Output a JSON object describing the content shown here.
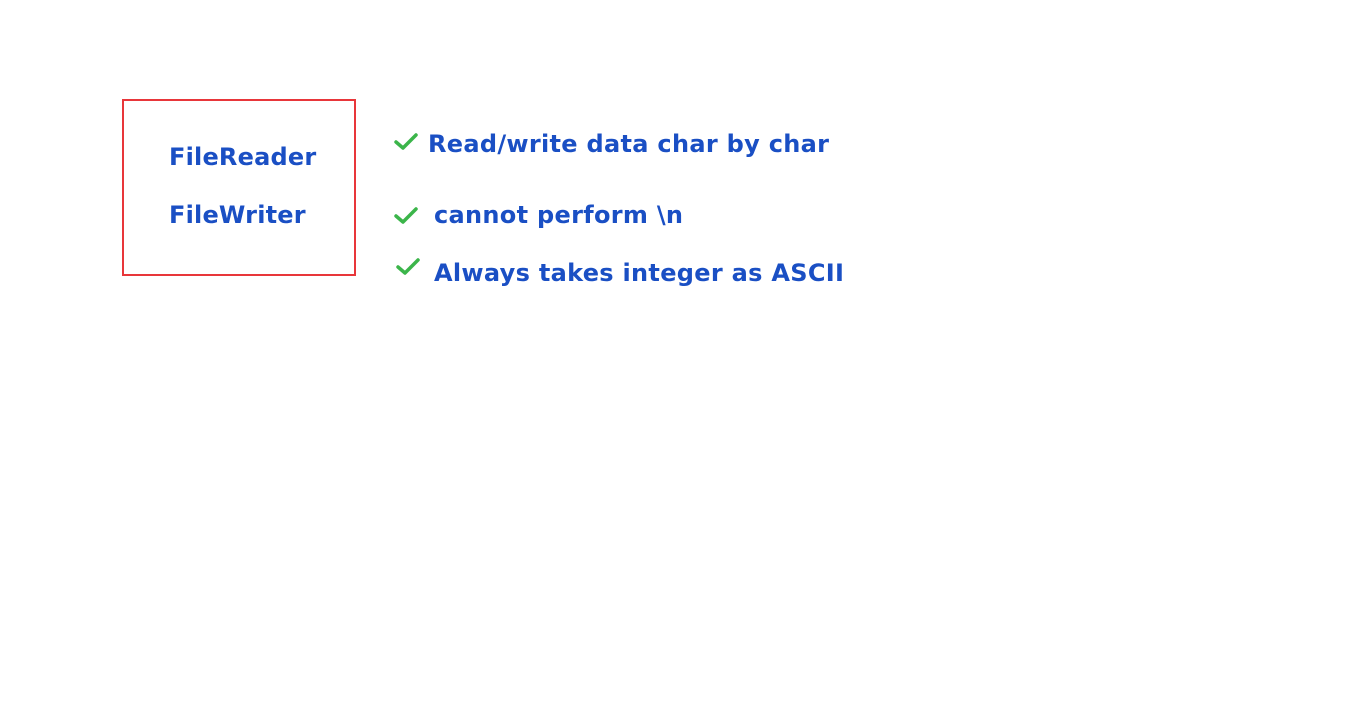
{
  "box": {
    "items": [
      "FileReader",
      "FileWriter"
    ],
    "border_color": "#e8363a"
  },
  "points": [
    {
      "icon": "check-icon",
      "text": "Read/write data char by char"
    },
    {
      "icon": "check-icon",
      "text": "cannot perform \\n"
    },
    {
      "icon": "check-icon",
      "text": "Always takes integer as ASCII"
    }
  ],
  "colors": {
    "text": "#1a4fc4",
    "check": "#3bb54a"
  }
}
